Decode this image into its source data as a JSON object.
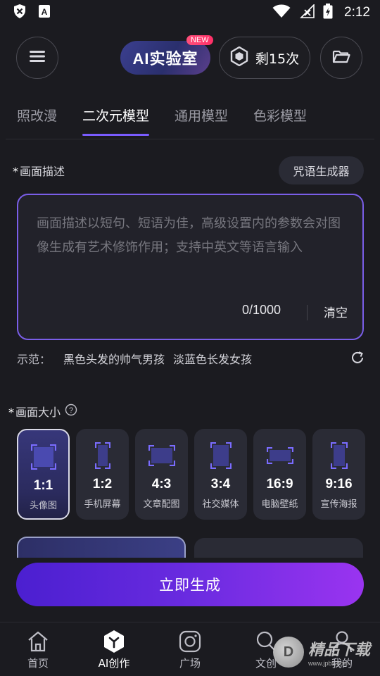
{
  "status_bar": {
    "time": "2:12"
  },
  "header": {
    "lab_title": "AI实验室",
    "new_tag": "NEW",
    "remaining": "剩15次"
  },
  "tabs": [
    {
      "label": "照改漫",
      "active": false
    },
    {
      "label": "二次元模型",
      "active": true
    },
    {
      "label": "通用模型",
      "active": false
    },
    {
      "label": "色彩模型",
      "active": false
    }
  ],
  "description": {
    "label": "画面描述",
    "required_mark": "*",
    "spell_button": "咒语生成器",
    "placeholder": "画面描述以短句、短语为佳，高级设置内的参数会对图像生成有艺术修饰作用；支持中英文等语言输入",
    "counter": "0/1000",
    "clear": "清空"
  },
  "examples": {
    "label": "示范：",
    "items": [
      "黑色头发的帅气男孩",
      "淡蓝色长发女孩"
    ]
  },
  "size": {
    "label": "画面大小",
    "required_mark": "*",
    "options": [
      {
        "ratio": "1:1",
        "name": "头像图",
        "active": true
      },
      {
        "ratio": "1:2",
        "name": "手机屏幕",
        "active": false
      },
      {
        "ratio": "4:3",
        "name": "文章配图",
        "active": false
      },
      {
        "ratio": "3:4",
        "name": "社交媒体",
        "active": false
      },
      {
        "ratio": "16:9",
        "name": "电脑壁纸",
        "active": false
      },
      {
        "ratio": "9:16",
        "name": "宣传海报",
        "active": false
      }
    ]
  },
  "generate_button": "立即生成",
  "bottom_nav": [
    {
      "label": "首页",
      "icon": "home-icon",
      "active": false
    },
    {
      "label": "AI创作",
      "icon": "ai-create-icon",
      "active": true
    },
    {
      "label": "广场",
      "icon": "square-icon",
      "active": false
    },
    {
      "label": "文创",
      "icon": "search-icon",
      "active": false
    },
    {
      "label": "我的",
      "icon": "profile-icon",
      "active": false
    }
  ],
  "watermark": {
    "text": "精品下载",
    "url_text": "www.jpbs.com"
  },
  "colors": {
    "accent": "#7a5cff",
    "button_start": "#4b1fd0",
    "button_end": "#9a34f0",
    "background": "#1b1b20"
  }
}
